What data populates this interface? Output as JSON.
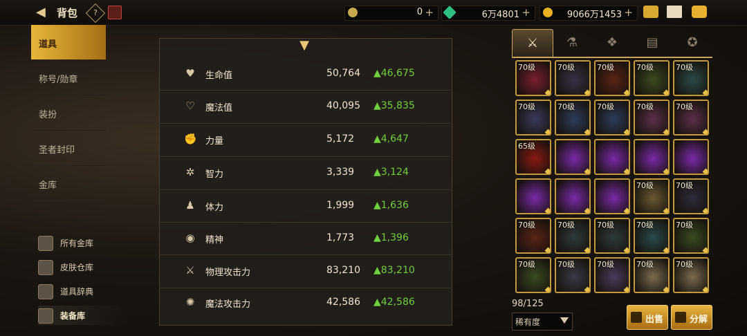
{
  "header": {
    "title": "背包",
    "help": "?",
    "currencies": [
      {
        "icon": "coin-c-icon",
        "value": "0",
        "color": "#c8a84c"
      },
      {
        "icon": "green-gem-icon",
        "value": "6万4801",
        "color": "#2fc080"
      },
      {
        "icon": "gold-coin-icon",
        "value": "9066万1453",
        "color": "#e8b020"
      }
    ],
    "icons": [
      "cart-icon",
      "mail-icon",
      "chat-icon"
    ]
  },
  "sidebar": {
    "items": [
      {
        "label": "道具",
        "active": true
      },
      {
        "label": "称号/勋章",
        "active": false
      },
      {
        "label": "装扮",
        "active": false
      },
      {
        "label": "圣者封印",
        "active": false
      },
      {
        "label": "金库",
        "active": false
      }
    ],
    "links": [
      {
        "label": "所有金库",
        "icon": "vault-icon",
        "active": false
      },
      {
        "label": "皮肤仓库",
        "icon": "skin-icon",
        "active": false
      },
      {
        "label": "道具辞典",
        "icon": "book-icon",
        "active": false
      },
      {
        "label": "装备库",
        "icon": "armor-icon",
        "active": true
      }
    ]
  },
  "stats": {
    "rows": [
      {
        "name": "生命值",
        "value": "50,764",
        "delta": "▲46,675",
        "icon": "heart-icon",
        "glyph": "♥"
      },
      {
        "name": "魔法值",
        "value": "40,095",
        "delta": "▲35,835",
        "icon": "heart-outline-icon",
        "glyph": "♡"
      },
      {
        "name": "力量",
        "value": "5,172",
        "delta": "▲4,647",
        "icon": "fist-icon",
        "glyph": "✊"
      },
      {
        "name": "智力",
        "value": "3,339",
        "delta": "▲3,124",
        "icon": "star-burst-icon",
        "glyph": "✲"
      },
      {
        "name": "体力",
        "value": "1,999",
        "delta": "▲1,636",
        "icon": "body-icon",
        "glyph": "♟"
      },
      {
        "name": "精神",
        "value": "1,773",
        "delta": "▲1,396",
        "icon": "spirit-icon",
        "glyph": "◉"
      },
      {
        "name": "物理攻击力",
        "value": "83,210",
        "delta": "▲83,210",
        "icon": "sword-icon",
        "glyph": "⚔"
      },
      {
        "name": "魔法攻击力",
        "value": "42,586",
        "delta": "▲42,586",
        "icon": "magic-icon",
        "glyph": "✺"
      }
    ]
  },
  "inventory": {
    "tabs": [
      {
        "icon": "equipment-icon",
        "glyph": "⚔",
        "active": true
      },
      {
        "icon": "potion-icon",
        "glyph": "⚗",
        "active": false
      },
      {
        "icon": "material-icon",
        "glyph": "❖",
        "active": false
      },
      {
        "icon": "cards-icon",
        "glyph": "▤",
        "active": false
      },
      {
        "icon": "pentagram-icon",
        "glyph": "✪",
        "active": false
      }
    ],
    "slots": [
      {
        "level": "70级",
        "color": "#7a1f2e"
      },
      {
        "level": "70级",
        "color": "#3a3046"
      },
      {
        "level": "70级",
        "color": "#5a2418"
      },
      {
        "level": "70级",
        "color": "#3c4a22"
      },
      {
        "level": "70级",
        "color": "#2c4a48"
      },
      {
        "level": "70级",
        "color": "#3a3a5a"
      },
      {
        "level": "70级",
        "color": "#2e3c5a"
      },
      {
        "level": "70级",
        "color": "#2e3c5a"
      },
      {
        "level": "70级",
        "color": "#5a3048"
      },
      {
        "level": "70级",
        "color": "#5a3048"
      },
      {
        "level": "65级",
        "color": "#8a1a14"
      },
      {
        "level": "",
        "color": "#7a2aa8"
      },
      {
        "level": "",
        "color": "#7a2aa8"
      },
      {
        "level": "",
        "color": "#7a2aa8"
      },
      {
        "level": "",
        "color": "#7a2aa8"
      },
      {
        "level": "",
        "color": "#7a2aa8"
      },
      {
        "level": "",
        "color": "#7a2aa8"
      },
      {
        "level": "",
        "color": "#7a2aa8"
      },
      {
        "level": "70级",
        "color": "#6a5a34"
      },
      {
        "level": "70级",
        "color": "#2e2a3a"
      },
      {
        "level": "70级",
        "color": "#5a2418"
      },
      {
        "level": "70级",
        "color": "#2e3a3a"
      },
      {
        "level": "70级",
        "color": "#2e3a3a"
      },
      {
        "level": "70级",
        "color": "#2a4a4a"
      },
      {
        "level": "70级",
        "color": "#3a4a22"
      },
      {
        "level": "70级",
        "color": "#3a4a22"
      },
      {
        "level": "70级",
        "color": "#3a3a46"
      },
      {
        "level": "70级",
        "color": "#4a3a5a"
      },
      {
        "level": "70级",
        "color": "#7a6a50"
      },
      {
        "level": "70级",
        "color": "#7a6a50"
      }
    ],
    "count": "98/125",
    "sort": "稀有度",
    "sell_label": "出售",
    "decompose_label": "分解"
  }
}
